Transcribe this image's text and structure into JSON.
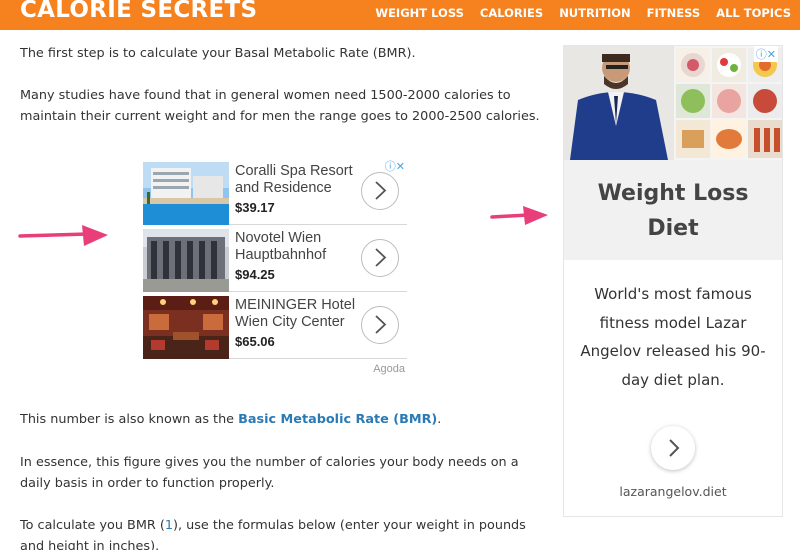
{
  "header": {
    "logo": "CALORIE SECRETS",
    "nav": [
      "WEIGHT LOSS",
      "CALORIES",
      "NUTRITION",
      "FITNESS",
      "ALL TOPICS"
    ],
    "color": "#f5821f"
  },
  "article": {
    "p1": "The first step is to calculate your Basal Metabolic Rate (BMR).",
    "p2": "Many studies have found that in general women need 1500-2000 calories to maintain their current weight and for men the range goes to 2000-2500 calories.",
    "p3_before": "This number is also known as the ",
    "p3_link": "Basic Metabolic Rate (BMR)",
    "p3_after": ".",
    "p4": "In essence, this figure gives you the number of calories your body needs on a daily basis in order to function properly.",
    "p5_before": "To calculate you BMR (",
    "p5_link": "1",
    "p5_after": "), use the formulas below (enter your weight in pounds and height in inches).",
    "link_color": "#2a7ab5"
  },
  "hotel_ad": {
    "adchoice": "ⓘ✕",
    "hotels": [
      {
        "name": "Coralli Spa Resort and Residence",
        "price": "$39.17"
      },
      {
        "name": "Novotel Wien Hauptbahnhof",
        "price": "$94.25"
      },
      {
        "name": "MEININGER Hotel Wien City Center",
        "price": "$65.06"
      }
    ],
    "sponsor": "Agoda"
  },
  "diet_ad": {
    "adchoice": "ⓘ✕",
    "heading": "Weight Loss Diet",
    "text": "World's most famous fitness model Lazar Angelov released his 90-day diet plan.",
    "url": "lazarangelov.diet"
  },
  "annotation_color": "#e83e7a"
}
